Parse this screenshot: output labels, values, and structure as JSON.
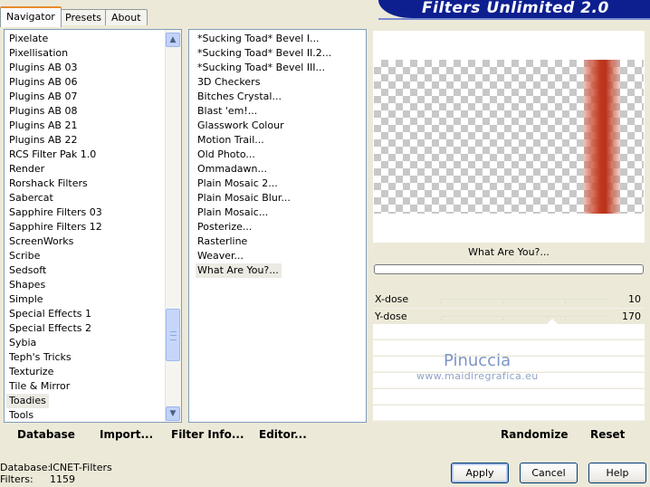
{
  "tabs": [
    {
      "label": "Navigator",
      "active": true
    },
    {
      "label": "Presets",
      "active": false
    },
    {
      "label": "About",
      "active": false
    }
  ],
  "banner_title": "Filters Unlimited 2.0",
  "categories": [
    "Pixelate",
    "Pixellisation",
    "Plugins AB 03",
    "Plugins AB 06",
    "Plugins AB 07",
    "Plugins AB 08",
    "Plugins AB 21",
    "Plugins AB 22",
    "RCS Filter Pak 1.0",
    "Render",
    "Rorshack Filters",
    "Sabercat",
    "Sapphire Filters 03",
    "Sapphire Filters 12",
    "ScreenWorks",
    "Scribe",
    "Sedsoft",
    "Shapes",
    "Simple",
    "Special Effects 1",
    "Special Effects 2",
    "Sybia",
    "Teph's Tricks",
    "Texturize",
    "Tile & Mirror",
    "Toadies",
    "Tools"
  ],
  "selected_category": "Toadies",
  "filters": [
    "*Sucking Toad*  Bevel I...",
    "*Sucking Toad*  Bevel II.2...",
    "*Sucking Toad*  Bevel III...",
    "3D Checkers",
    "Bitches Crystal...",
    "Blast 'em!...",
    "Glasswork Colour",
    "Motion Trail...",
    "Old Photo...",
    "Ommadawn...",
    "Plain Mosaic 2...",
    "Plain Mosaic Blur...",
    "Plain Mosaic...",
    "Posterize...",
    "Rasterline",
    "Weaver...",
    "What Are You?..."
  ],
  "selected_filter": "What Are You?...",
  "preview": {
    "filter_name": "What Are You?...",
    "progress": 0
  },
  "sliders": [
    {
      "label": "X-dose",
      "value": "10"
    },
    {
      "label": "Y-dose",
      "value": "170"
    }
  ],
  "watermark": {
    "name": "Pinuccia",
    "url": "www.maidiregrafica.eu"
  },
  "bottom": {
    "database": "Database",
    "import": "Import...",
    "filter_info": "Filter Info...",
    "editor": "Editor...",
    "randomize": "Randomize",
    "reset": "Reset"
  },
  "info": {
    "database_label": "Database:",
    "database_value": "ICNET-Filters",
    "filters_label": "Filters:",
    "filters_value": "1159"
  },
  "buttons": {
    "apply": "Apply",
    "cancel": "Cancel",
    "help": "Help"
  },
  "colors": {
    "banner": "#0d1f8f",
    "accent_tab": "#e68b2c",
    "preview_bar": "#b8321b"
  }
}
